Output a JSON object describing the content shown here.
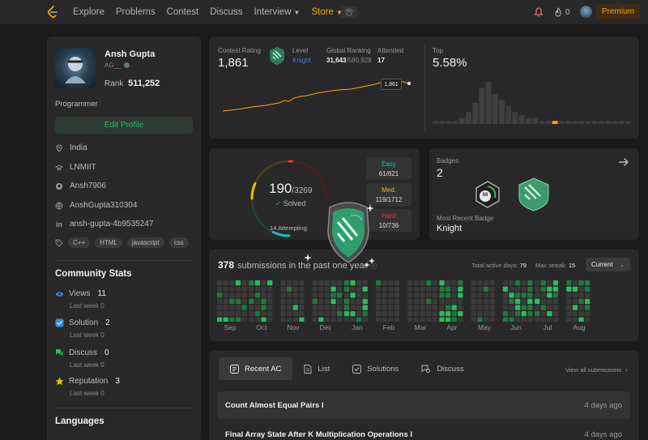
{
  "nav": {
    "links": [
      "Explore",
      "Problems",
      "Contest",
      "Discuss",
      "Interview",
      "Store"
    ],
    "streak": "0",
    "premium": "Premium"
  },
  "profile": {
    "name": "Ansh Gupta",
    "handle": "AG__",
    "rank_label": "Rank",
    "rank_value": "511,252",
    "title": "Programmer",
    "edit_button": "Edit Profile",
    "location": "India",
    "school": "LNMIIT",
    "github": "Ansh7906",
    "leetcode": "AnshGupta310304",
    "linkedin": "ansh-gupta-4b9535247",
    "skills": [
      "C++",
      "HTML",
      "javascript",
      "css"
    ]
  },
  "community": {
    "title": "Community Stats",
    "items": [
      {
        "label": "Views",
        "value": "11",
        "sub": "Last week 0"
      },
      {
        "label": "Solution",
        "value": "2",
        "sub": "Last week 0"
      },
      {
        "label": "Discuss",
        "value": "0",
        "sub": "Last week 0"
      },
      {
        "label": "Reputation",
        "value": "3",
        "sub": "Last week 0"
      }
    ]
  },
  "languages": {
    "title": "Languages"
  },
  "contest": {
    "rating_label": "Contest Rating",
    "rating": "1,861",
    "level_label": "Level",
    "level": "Knight",
    "global_label": "Global Ranking",
    "global_rank": "31,643",
    "global_total": "/580,928",
    "attended_label": "Attended",
    "attended": "17",
    "tooltip": "1,861",
    "top_label": "Top",
    "top_value": "5.58%",
    "histogram": [
      1,
      1,
      1,
      1,
      2,
      4,
      7,
      12,
      14,
      10,
      8,
      6,
      4,
      3,
      2,
      2,
      1,
      1,
      1,
      1,
      1,
      1,
      1,
      1,
      1,
      1,
      1,
      1,
      1,
      1
    ],
    "highlight_index": 18
  },
  "problems": {
    "solved": "190",
    "total": "/3269",
    "solved_label": "Solved",
    "attempting": "14 Attempting",
    "easy_label": "Easy",
    "easy": "61/821",
    "med_label": "Med.",
    "med": "119/1712",
    "hard_label": "Hard",
    "hard": "10/736",
    "easy_fraction": 0.074,
    "med_fraction": 0.069,
    "hard_fraction": 0.014
  },
  "badges": {
    "label": "Badges",
    "count": "2",
    "recent_label": "Most Recent Badge",
    "recent": "Knight",
    "badge2_text": "50"
  },
  "calendar": {
    "count": "378",
    "text": "submissions in the past one year",
    "active_label": "Total active days:",
    "active": "79",
    "streak_label": "Max streak:",
    "streak": "15",
    "dropdown": "Current",
    "months": [
      "Sep",
      "Oct",
      "Nov",
      "Dec",
      "Jan",
      "Feb",
      "Mar",
      "Apr",
      "May",
      "Jun",
      "Jul",
      "Aug"
    ]
  },
  "recent": {
    "tabs": [
      "Recent AC",
      "List",
      "Solutions",
      "Discuss"
    ],
    "view_all": "View all submissions",
    "items": [
      {
        "title": "Count Almost Equal Pairs I",
        "time": "4 days ago"
      },
      {
        "title": "Final Array State After K Multiplication Operations I",
        "time": "4 days ago"
      }
    ]
  },
  "colors": {
    "accent": "#ffa116",
    "easy": "#1cbaba",
    "medium": "#ffb700",
    "hard": "#f63737",
    "green": "#2cbb5d"
  }
}
